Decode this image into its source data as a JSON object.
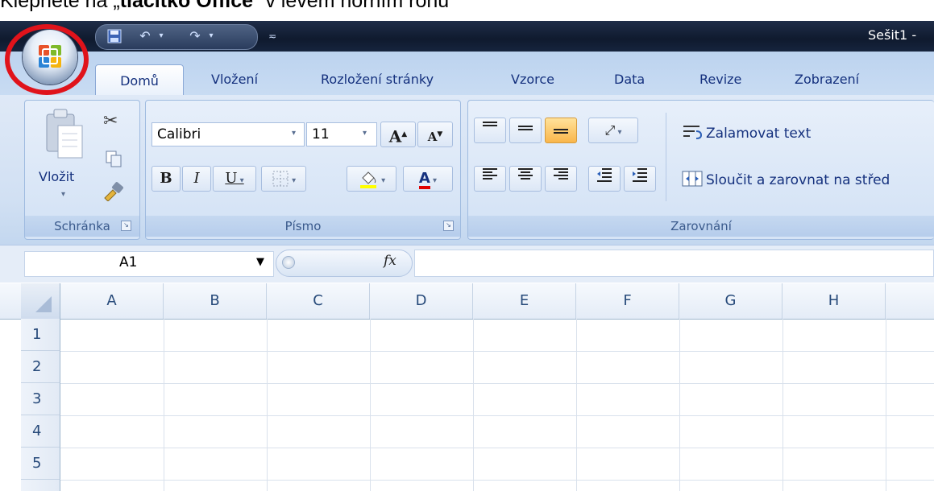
{
  "caption": {
    "prefix": "Klepněte na „",
    "bold": "tlačítko Office",
    "suffix": "“ v levém horním rohu"
  },
  "window": {
    "title": "Sešit1 -"
  },
  "tabs": [
    "Domů",
    "Vložení",
    "Rozložení stránky",
    "Vzorce",
    "Data",
    "Revize",
    "Zobrazení"
  ],
  "clipboard": {
    "paste_label": "Vložit",
    "group_label": "Schránka"
  },
  "font": {
    "name": "Calibri",
    "size": "11",
    "group_label": "Písmo",
    "bold": "B",
    "italic": "I",
    "underline": "U",
    "grow": "A",
    "shrink": "A",
    "font_color": "A"
  },
  "alignment": {
    "wrap_text": "Zalamovat text",
    "merge_center": "Sloučit a zarovnat na střed",
    "group_label": "Zarovnání"
  },
  "formula_bar": {
    "cell_ref": "A1",
    "fx": "fx"
  },
  "columns": [
    "A",
    "B",
    "C",
    "D",
    "E",
    "F",
    "G",
    "H"
  ],
  "rows": [
    "1",
    "2",
    "3",
    "4",
    "5"
  ],
  "colors": {
    "highlight": "#ffff00",
    "font_color": "#e00000",
    "annotation": "#e0131b"
  }
}
